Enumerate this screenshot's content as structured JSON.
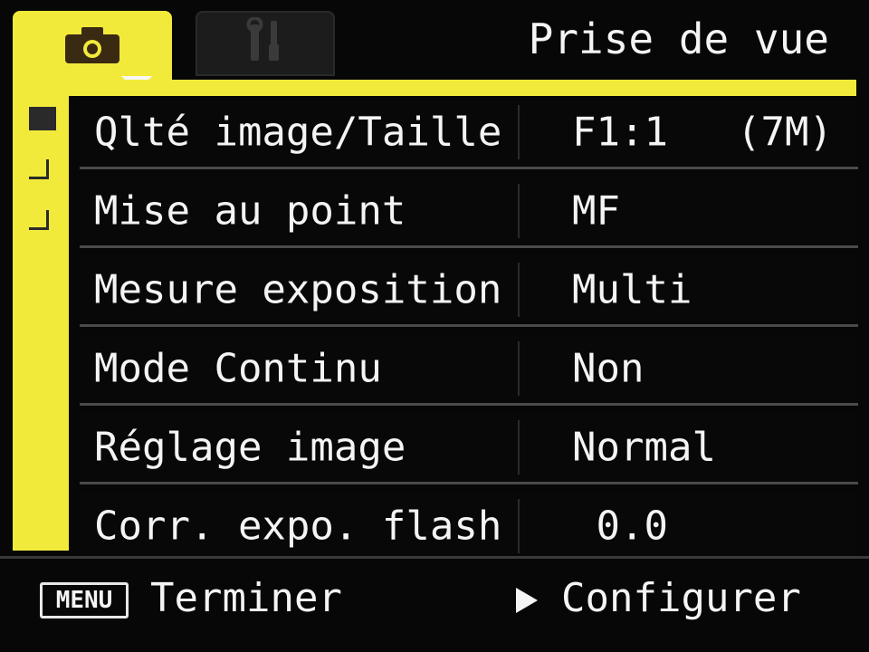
{
  "header": {
    "title": "Prise de vue",
    "tabs": [
      {
        "name": "camera-icon",
        "active": true
      },
      {
        "name": "wrench-screwdriver-icon",
        "active": false
      }
    ]
  },
  "menu": {
    "rows": [
      {
        "label": "Qlté image/Taille",
        "value": "F1:1",
        "extra": "(7M)"
      },
      {
        "label": "Mise au point",
        "value": "MF"
      },
      {
        "label": "Mesure exposition",
        "value": "Multi"
      },
      {
        "label": "Mode Continu",
        "value": "Non"
      },
      {
        "label": "Réglage image",
        "value": "Normal"
      },
      {
        "label": "Corr. expo. flash",
        "value": " 0.0"
      }
    ]
  },
  "footer": {
    "menu_key": "MENU",
    "left_label": "Terminer",
    "right_label": "Configurer"
  },
  "colors": {
    "accent_yellow": "#f2ea3a",
    "background": "#070707",
    "text": "#f4f4f4"
  }
}
